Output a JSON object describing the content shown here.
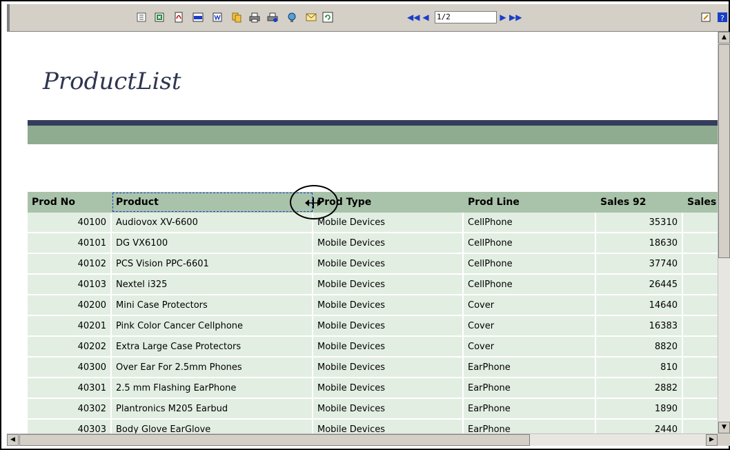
{
  "toolbar": {
    "icons": [
      "outline-icon",
      "excel-export-icon",
      "pdf-export-icon",
      "csv-export-icon",
      "word-export-icon",
      "copy-icon",
      "print-icon",
      "print-setup-icon",
      "send-icon",
      "email-icon",
      "refresh-icon"
    ],
    "page_value": "1/2",
    "right_icons": [
      "edit-icon",
      "help-icon"
    ]
  },
  "report": {
    "title": "ProductList"
  },
  "table": {
    "columns": [
      "Prod No",
      "Product",
      "Prod Type",
      "Prod Line",
      "Sales 92",
      "Sales"
    ],
    "rows": [
      [
        "40100",
        "Audiovox XV-6600",
        "Mobile Devices",
        "CellPhone",
        "35310"
      ],
      [
        "40101",
        "DG VX6100",
        "Mobile Devices",
        "CellPhone",
        "18630"
      ],
      [
        "40102",
        "PCS Vision PPC-6601",
        "Mobile Devices",
        "CellPhone",
        "37740"
      ],
      [
        "40103",
        "Nextel i325",
        "Mobile Devices",
        "CellPhone",
        "26445"
      ],
      [
        "40200",
        "Mini Case Protectors",
        "Mobile Devices",
        "Cover",
        "14640"
      ],
      [
        "40201",
        "Pink Color Cancer Cellphone",
        "Mobile Devices",
        "Cover",
        "16383"
      ],
      [
        "40202",
        "Extra Large Case Protectors",
        "Mobile Devices",
        "Cover",
        "8820"
      ],
      [
        "40300",
        "Over Ear For 2.5mm Phones",
        "Mobile Devices",
        "EarPhone",
        "810"
      ],
      [
        "40301",
        "2.5 mm Flashing EarPhone",
        "Mobile Devices",
        "EarPhone",
        "2882"
      ],
      [
        "40302",
        "Plantronics M205 Earbud",
        "Mobile Devices",
        "EarPhone",
        "1890"
      ],
      [
        "40303",
        "Body Glove EarGlove",
        "Mobile Devices",
        "EarPhone",
        "2440"
      ]
    ]
  },
  "colors": {
    "header_bg": "#a9c3aa",
    "row_bg": "#e3eee3",
    "band_dark": "#343d5c",
    "band_light": "#8fab90",
    "title_color": "#2e3550"
  }
}
